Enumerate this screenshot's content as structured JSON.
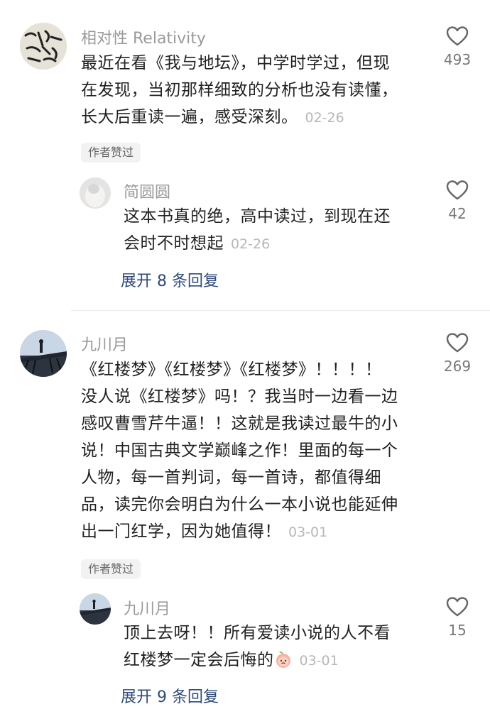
{
  "comments": [
    {
      "name": "相对性 Relativity",
      "text_lines": [
        "最近在看《我与地坛》，中学时学过，但现",
        "在发现，当初那样细致的分析也没有读懂，",
        "长大后重读一遍，感受深刻。"
      ],
      "date": "02-26",
      "likes": "493",
      "badge": "作者赞过",
      "reply": {
        "name": "简圆圆",
        "text_lines": [
          "这本书真的绝，高中读过，到现在还",
          "会时不时想起"
        ],
        "date": "02-26",
        "likes": "42"
      },
      "expand_label": "展开 8 条回复"
    },
    {
      "name": "九川月",
      "text_lines": [
        "《红楼梦》《红楼梦》《红楼梦》！！！！",
        "没人说《红楼梦》吗！？我当时一边看一边",
        "感叹曹雪芹牛逼！！这就是我读过最牛的小",
        "说！中国古典文学巅峰之作！里面的每一个",
        "人物，每一首判词，每一首诗，都值得细",
        "品，读完你会明白为什么一本小说也能延伸",
        "出一门红学，因为她值得！"
      ],
      "date": "03-01",
      "likes": "269",
      "badge": "作者赞过",
      "reply": {
        "name": "九川月",
        "text_lines": [
          "顶上去呀！！所有爱读小说的人不看",
          "红楼梦一定会后悔的"
        ],
        "date": "03-01",
        "likes": "15"
      },
      "expand_label": "展开 9 条回复"
    }
  ],
  "icons": {
    "like": "heart-outline-icon",
    "emoji": "peach-emoji-icon"
  },
  "colors": {
    "name": "#9a9a9a",
    "text": "#222222",
    "date": "#b7b7b7",
    "expand": "#2f4a7a",
    "badge_bg": "#f2f2f2"
  }
}
